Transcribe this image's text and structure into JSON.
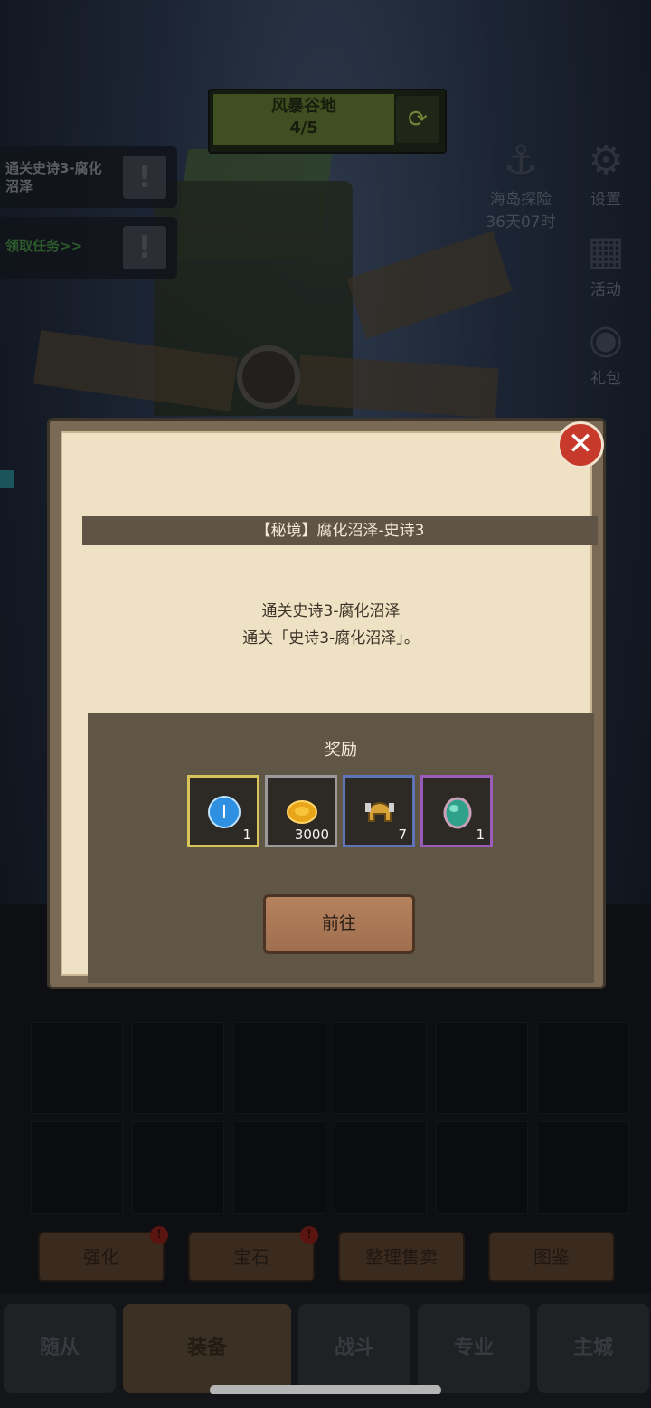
{
  "top": {
    "region_name": "风暴谷地",
    "region_progress": "4/5",
    "refresh_icon": "refresh-icon"
  },
  "quests": [
    {
      "label": "通关史诗3-腐化沼泽",
      "icon": "exclamation-icon"
    },
    {
      "label": "领取任务>>",
      "icon": "exclamation-icon"
    }
  ],
  "side_menu": {
    "island": {
      "label": "海岛探险",
      "timer": "36天07时"
    },
    "settings": "设置",
    "activity": "活动",
    "gift": "礼包"
  },
  "toolbar": [
    "强化",
    "宝石",
    "整理售卖",
    "图鉴"
  ],
  "nav": [
    "随从",
    "装备",
    "战斗",
    "专业",
    "主城"
  ],
  "dialog": {
    "title": "【秘境】腐化沼泽-史诗3",
    "desc_line1": "通关史诗3-腐化沼泽",
    "desc_line2": "通关「史诗3-腐化沼泽」。",
    "reward_title": "奖励",
    "rewards": [
      {
        "name": "blue-rune-icon",
        "count": "1",
        "frame": "#d7c35a"
      },
      {
        "name": "gold-coin-icon",
        "count": "3000",
        "frame": "#9a9a9a"
      },
      {
        "name": "helmet-icon",
        "count": "7",
        "frame": "#5f73b8"
      },
      {
        "name": "green-egg-icon",
        "count": "1",
        "frame": "#9b5bb8"
      }
    ],
    "go_label": "前往",
    "close_icon": "close-icon"
  }
}
